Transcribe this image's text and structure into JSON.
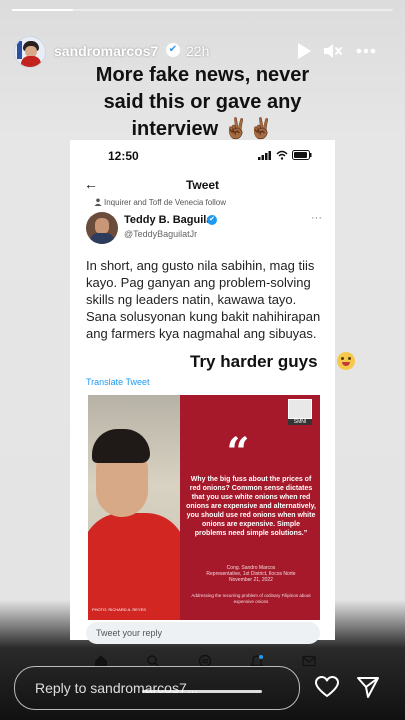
{
  "story": {
    "progress": 0.16
  },
  "header": {
    "username": "sandromarcos7",
    "time": "22h",
    "icons": [
      "verified-icon",
      "play-icon",
      "mute-icon",
      "more-icon"
    ]
  },
  "caption": {
    "lines": [
      "More fake news, never",
      "said this or gave any",
      "interview ✌🏾✌🏾"
    ]
  },
  "tweet": {
    "status_time": "12:50",
    "nav_title": "Tweet",
    "follow_note": "Inquirer and Toff de Venecia follow",
    "name": "Teddy B. Baguilat",
    "handle": "@TeddyBaguilatJr",
    "body": "In short, ang gusto nila sabihin, mag tiis kayo. Pag ganyan ang problem-solving skills ng leaders natin, kawawa tayo. Sana solusyonan kung bakit nahihirapan ang farmers kya nagmahal ang sibuyas.",
    "translate": "Translate Tweet",
    "reply_placeholder": "Tweet your reply",
    "tabbar_icons": [
      "home-icon",
      "search-icon",
      "spaces-icon",
      "notifications-icon",
      "messages-icon"
    ]
  },
  "quote_card": {
    "logo": "SMNI",
    "mark": "“",
    "text": "Why the big fuss about the prices of red onions? Common sense dictates that you use white onions when red onions are expensive and alternatively, you should use red onions when white onions are expensive. Simple problems need simple solutions.”",
    "speaker": "Cong. Sandro Marcos",
    "role": "Representative, 1st District, Ilocos Norte",
    "date": "November 21, 2022",
    "note": "Addressing the recurring problem of ordinary Filipinos about expensive onions",
    "credit": "PHOTO: RICHARD A. REYES"
  },
  "overlay": {
    "text": "Try harder guys",
    "emoji": "winking-tongue-emoji"
  },
  "footer": {
    "reply_placeholder": "Reply to sandromarcos7...",
    "icons": [
      "heart-icon",
      "send-icon"
    ]
  }
}
